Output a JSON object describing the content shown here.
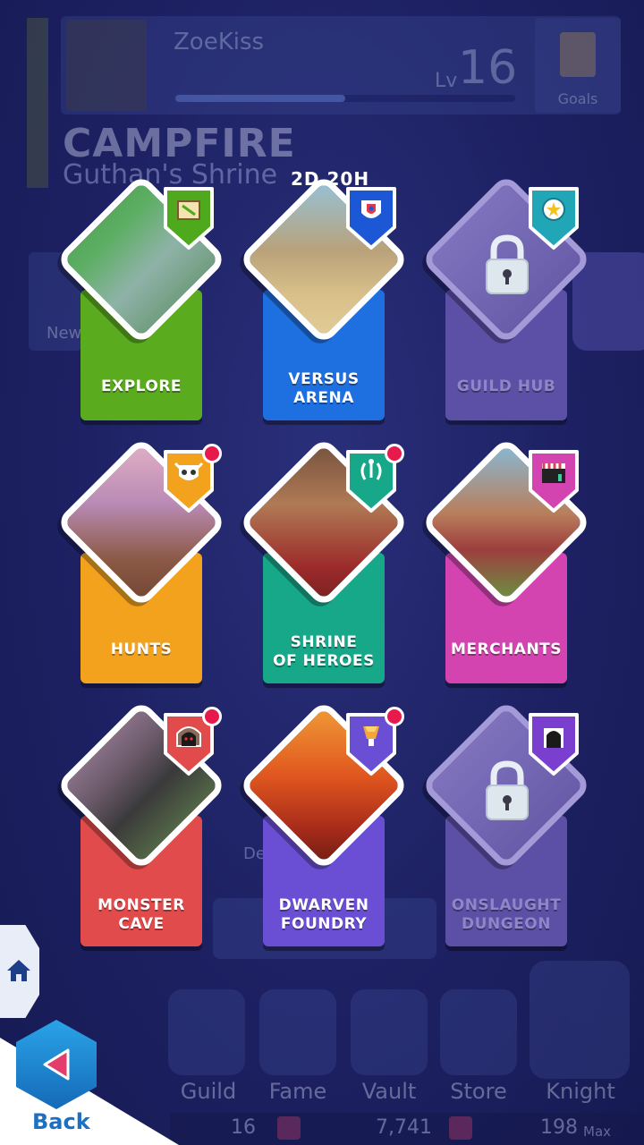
{
  "header": {
    "username": "ZoeKiss",
    "level_prefix": "Lv",
    "level": "16",
    "goals_label": "Goals",
    "location": "CAMPFIRE",
    "sublocation": "Guthan's Shrine",
    "xp_fraction": 0.5
  },
  "side": {
    "news_label": "New",
    "mid_text": "De          rd"
  },
  "timer": "2D 20H",
  "cards": [
    {
      "label": "EXPLORE",
      "color": "#5aac1e",
      "tag_color": "#4ea91c",
      "locked": false,
      "notify": false
    },
    {
      "label": "VERSUS\nARENA",
      "color": "#1e6fe0",
      "tag_color": "#1c58d6",
      "locked": false,
      "notify": false
    },
    {
      "label": "GUILD HUB",
      "color": "#6a5cb8",
      "tag_color": "#21a6b8",
      "locked": true,
      "notify": false
    },
    {
      "label": "HUNTS",
      "color": "#f3a21e",
      "tag_color": "#f3a21e",
      "locked": false,
      "notify": true
    },
    {
      "label": "SHRINE\nOF HEROES",
      "color": "#17a88a",
      "tag_color": "#17a88a",
      "locked": false,
      "notify": true
    },
    {
      "label": "MERCHANTS",
      "color": "#d444b0",
      "tag_color": "#d444b0",
      "locked": false,
      "notify": false
    },
    {
      "label": "MONSTER\nCAVE",
      "color": "#e24b4b",
      "tag_color": "#e24b4b",
      "locked": false,
      "notify": true
    },
    {
      "label": "DWARVEN\nFOUNDRY",
      "color": "#6a4fd4",
      "tag_color": "#6a4fd4",
      "locked": false,
      "notify": true
    },
    {
      "label": "ONSLAUGHT\nDUNGEON",
      "color": "#6a5cb8",
      "tag_color": "#7b3fd0",
      "locked": true,
      "notify": false
    }
  ],
  "nav": [
    "Guild",
    "Fame",
    "Vault",
    "Store",
    "Knight"
  ],
  "resources": {
    "gems": "16",
    "gold": "7,741",
    "energy": "198",
    "energy_suffix": "Max"
  },
  "controls": {
    "back_label": "Back"
  }
}
